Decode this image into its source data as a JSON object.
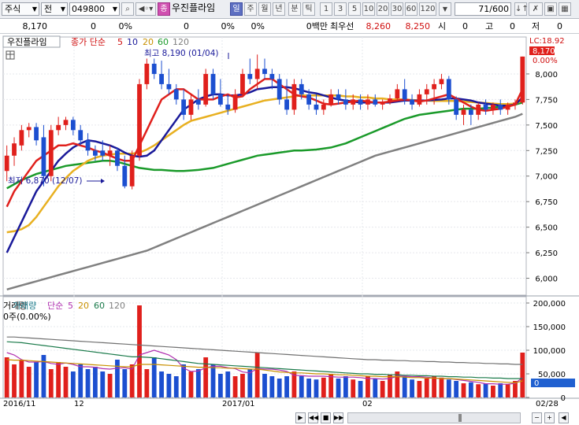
{
  "toolbar": {
    "market": "주식",
    "type": "전",
    "code": "049800",
    "name": "우진플라임",
    "period_day": "일",
    "period_week": "주",
    "period_month": "월",
    "period_year": "년",
    "period_min": "분",
    "period_tick": "틱",
    "intervals": [
      "1",
      "3",
      "5",
      "10",
      "20",
      "30",
      "60",
      "120"
    ],
    "count": "71",
    "total": "/600"
  },
  "info": {
    "price": "8,170",
    "change": "0",
    "change_pct": "0%",
    "volume": "0",
    "vol_pct": "0%",
    "vol_pct2": "0%",
    "amount": "0백만",
    "best_label": "최우선",
    "ask": "8,260",
    "bid": "8,250",
    "open_label": "시",
    "open": "0",
    "high_label": "고",
    "high": "0",
    "low_label": "저",
    "low": "0"
  },
  "price_panel": {
    "title": "우진플라임",
    "ma_label": "종가 단순",
    "ma_periods": [
      "5",
      "10",
      "20",
      "60",
      "120"
    ],
    "lc": "LC:18.92",
    "last": "8,170",
    "last_pct": "0.00%",
    "high_annot": "최고 8,190 (01/04)",
    "low_annot": "최저 6,870 (12/07)"
  },
  "volume_panel": {
    "title": "거래량",
    "ma_label": "단순",
    "ma_periods": [
      "5",
      "20",
      "60",
      "120"
    ],
    "now": "0주(0.00%)",
    "last_tag": "0"
  },
  "x_labels": [
    "2016/11",
    "12",
    "2017/01",
    "02",
    "02/28"
  ],
  "colors": {
    "up": "#e0201c",
    "down": "#1c4fd0",
    "ma5": "#e0201c",
    "ma10": "#1a1a9a",
    "ma20": "#e8b020",
    "ma60": "#1a9a2a",
    "ma120": "#808080"
  },
  "chart_data": {
    "type": "candlestick",
    "price_ylim": [
      5850,
      8300
    ],
    "price_ticks": [
      6000,
      6250,
      6500,
      6750,
      7000,
      7250,
      7500,
      7750,
      8000
    ],
    "price_tick_labels": [
      "6,000",
      "6,250",
      "6,500",
      "6,750",
      "7,000",
      "7,250",
      "7,500",
      "7,750",
      "8,000"
    ],
    "volume_ylim": [
      0,
      210000
    ],
    "volume_ticks": [
      0,
      50000,
      100000,
      150000,
      200000
    ],
    "volume_tick_labels": [
      "0",
      "50,000",
      "100,000",
      "150,000",
      "200,000"
    ],
    "candles": [
      [
        7050,
        7300,
        6950,
        7200
      ],
      [
        7200,
        7380,
        7100,
        7320
      ],
      [
        7300,
        7500,
        7250,
        7450
      ],
      [
        7450,
        7520,
        7380,
        7480
      ],
      [
        7480,
        7520,
        7300,
        7350
      ],
      [
        7380,
        7500,
        6900,
        7000
      ],
      [
        7000,
        7500,
        6950,
        7450
      ],
      [
        7450,
        7580,
        7400,
        7500
      ],
      [
        7500,
        7580,
        7450,
        7550
      ],
      [
        7550,
        7580,
        7400,
        7450
      ],
      [
        7450,
        7500,
        7300,
        7350
      ],
      [
        7350,
        7420,
        7200,
        7250
      ],
      [
        7250,
        7300,
        7150,
        7200
      ],
      [
        7250,
        7350,
        7150,
        7200
      ],
      [
        7200,
        7300,
        7100,
        7250
      ],
      [
        7250,
        7280,
        7050,
        7100
      ],
      [
        7100,
        7200,
        6880,
        6900
      ],
      [
        6900,
        7250,
        6870,
        7200
      ],
      [
        7200,
        7950,
        7150,
        7900
      ],
      [
        7900,
        8150,
        7850,
        8100
      ],
      [
        8100,
        8150,
        7950,
        8000
      ],
      [
        8000,
        8130,
        7850,
        7900
      ],
      [
        7900,
        8050,
        7800,
        7850
      ],
      [
        7850,
        7900,
        7700,
        7750
      ],
      [
        7750,
        7850,
        7550,
        7600
      ],
      [
        7600,
        7800,
        7550,
        7750
      ],
      [
        7750,
        7850,
        7650,
        7700
      ],
      [
        7700,
        8050,
        7680,
        8000
      ],
      [
        8000,
        8050,
        7750,
        7800
      ],
      [
        7800,
        7950,
        7680,
        7700
      ],
      [
        7700,
        7800,
        7600,
        7650
      ],
      [
        7650,
        7850,
        7620,
        7800
      ],
      [
        7800,
        8050,
        7780,
        8000
      ],
      [
        8000,
        8150,
        7900,
        7950
      ],
      [
        7950,
        8190,
        7850,
        8050
      ],
      [
        8050,
        8150,
        7950,
        8000
      ],
      [
        8000,
        8050,
        7850,
        7950
      ],
      [
        7950,
        8000,
        7700,
        7750
      ],
      [
        7750,
        7950,
        7600,
        7650
      ],
      [
        7650,
        7950,
        7600,
        7900
      ],
      [
        7900,
        7950,
        7750,
        7800
      ],
      [
        7800,
        7850,
        7650,
        7700
      ],
      [
        7700,
        7800,
        7600,
        7650
      ],
      [
        7650,
        7750,
        7600,
        7700
      ],
      [
        7700,
        7850,
        7680,
        7800
      ],
      [
        7800,
        7850,
        7700,
        7750
      ],
      [
        7750,
        7850,
        7650,
        7700
      ],
      [
        7700,
        7800,
        7650,
        7750
      ],
      [
        7750,
        7800,
        7650,
        7700
      ],
      [
        7700,
        7800,
        7650,
        7750
      ],
      [
        7750,
        7800,
        7680,
        7700
      ],
      [
        7700,
        7750,
        7650,
        7720
      ],
      [
        7720,
        7800,
        7700,
        7760
      ],
      [
        7760,
        7900,
        7750,
        7850
      ],
      [
        7850,
        7950,
        7700,
        7750
      ],
      [
        7750,
        7800,
        7650,
        7700
      ],
      [
        7700,
        7850,
        7680,
        7800
      ],
      [
        7800,
        7900,
        7700,
        7850
      ],
      [
        7850,
        7950,
        7700,
        7900
      ],
      [
        7900,
        8000,
        7850,
        7950
      ],
      [
        7950,
        7980,
        7700,
        7750
      ],
      [
        7750,
        7780,
        7550,
        7600
      ],
      [
        7600,
        7700,
        7500,
        7650
      ],
      [
        7650,
        7700,
        7500,
        7600
      ],
      [
        7600,
        7720,
        7550,
        7700
      ],
      [
        7700,
        7750,
        7600,
        7650
      ],
      [
        7650,
        7720,
        7600,
        7700
      ],
      [
        7700,
        7750,
        7600,
        7650
      ],
      [
        7650,
        7720,
        7600,
        7700
      ],
      [
        7700,
        7750,
        7650,
        7720
      ],
      [
        7720,
        8170,
        7700,
        8170
      ]
    ],
    "volume": [
      85000,
      70000,
      80000,
      65000,
      75000,
      90000,
      60000,
      75000,
      65000,
      55000,
      70000,
      60000,
      65000,
      55000,
      50000,
      80000,
      60000,
      70000,
      195000,
      60000,
      85000,
      55000,
      50000,
      45000,
      70000,
      55000,
      60000,
      85000,
      70000,
      50000,
      55000,
      45000,
      50000,
      60000,
      95000,
      50000,
      45000,
      40000,
      45000,
      55000,
      45000,
      40000,
      38000,
      42000,
      50000,
      40000,
      45000,
      38000,
      35000,
      45000,
      40000,
      35000,
      48000,
      55000,
      45000,
      38000,
      35000,
      40000,
      45000,
      42000,
      38000,
      35000,
      30000,
      32000,
      28000,
      30000,
      25000,
      30000,
      28000,
      35000,
      95000
    ],
    "ma_series": [
      {
        "name": "5",
        "values": [
          6700,
          6850,
          6950,
          7050,
          7150,
          7200,
          7250,
          7300,
          7300,
          7320,
          7300,
          7280,
          7250,
          7230,
          7200,
          7170,
          7150,
          7150,
          7300,
          7450,
          7600,
          7750,
          7800,
          7850,
          7850,
          7800,
          7750,
          7750,
          7750,
          7780,
          7800,
          7770,
          7780,
          7850,
          7900,
          7950,
          7950,
          7900,
          7850,
          7800,
          7780,
          7770,
          7740,
          7710,
          7700,
          7710,
          7720,
          7730,
          7740,
          7730,
          7720,
          7720,
          7730,
          7740,
          7750,
          7740,
          7730,
          7740,
          7760,
          7780,
          7800,
          7760,
          7720,
          7680,
          7650,
          7640,
          7650,
          7660,
          7680,
          7700,
          7850
        ]
      },
      {
        "name": "10",
        "values": [
          6250,
          6400,
          6550,
          6700,
          6850,
          6950,
          7050,
          7150,
          7220,
          7280,
          7320,
          7350,
          7340,
          7320,
          7300,
          7270,
          7230,
          7200,
          7190,
          7200,
          7250,
          7350,
          7450,
          7550,
          7650,
          7700,
          7750,
          7780,
          7800,
          7800,
          7790,
          7790,
          7800,
          7820,
          7850,
          7860,
          7870,
          7870,
          7870,
          7860,
          7840,
          7820,
          7810,
          7790,
          7770,
          7750,
          7740,
          7730,
          7720,
          7720,
          7720,
          7720,
          7720,
          7730,
          7740,
          7740,
          7740,
          7740,
          7745,
          7750,
          7760,
          7760,
          7750,
          7740,
          7720,
          7710,
          7700,
          7690,
          7690,
          7700,
          7770
        ]
      },
      {
        "name": "20",
        "values": [
          6450,
          6460,
          6480,
          6520,
          6600,
          6700,
          6800,
          6900,
          6980,
          7050,
          7100,
          7150,
          7180,
          7200,
          7210,
          7220,
          7220,
          7220,
          7230,
          7260,
          7300,
          7350,
          7400,
          7450,
          7500,
          7540,
          7560,
          7580,
          7600,
          7620,
          7640,
          7660,
          7680,
          7700,
          7720,
          7740,
          7750,
          7760,
          7770,
          7780,
          7790,
          7790,
          7790,
          7790,
          7790,
          7790,
          7780,
          7780,
          7770,
          7770,
          7760,
          7760,
          7750,
          7750,
          7750,
          7745,
          7740,
          7740,
          7735,
          7735,
          7735,
          7735,
          7730,
          7725,
          7720,
          7715,
          7710,
          7705,
          7705,
          7710,
          7740
        ]
      },
      {
        "name": "60",
        "values": [
          6880,
          6920,
          6960,
          6990,
          7020,
          7040,
          7060,
          7080,
          7100,
          7110,
          7120,
          7130,
          7140,
          7150,
          7150,
          7140,
          7120,
          7100,
          7080,
          7070,
          7060,
          7060,
          7055,
          7050,
          7050,
          7055,
          7060,
          7070,
          7080,
          7100,
          7120,
          7140,
          7160,
          7180,
          7200,
          7210,
          7220,
          7230,
          7240,
          7250,
          7250,
          7255,
          7260,
          7270,
          7280,
          7300,
          7320,
          7350,
          7380,
          7410,
          7440,
          7470,
          7500,
          7530,
          7560,
          7580,
          7600,
          7610,
          7620,
          7630,
          7640,
          7650,
          7660,
          7660,
          7660,
          7665,
          7670,
          7680,
          7690,
          7700,
          7720
        ]
      },
      {
        "name": "120",
        "values": [
          5890,
          5910,
          5930,
          5950,
          5970,
          5990,
          6010,
          6030,
          6050,
          6070,
          6090,
          6110,
          6130,
          6150,
          6170,
          6190,
          6210,
          6230,
          6250,
          6270,
          6300,
          6330,
          6360,
          6390,
          6420,
          6450,
          6480,
          6510,
          6540,
          6570,
          6600,
          6630,
          6660,
          6690,
          6720,
          6750,
          6780,
          6810,
          6840,
          6870,
          6900,
          6930,
          6960,
          6990,
          7020,
          7050,
          7080,
          7110,
          7140,
          7170,
          7200,
          7220,
          7240,
          7260,
          7280,
          7300,
          7320,
          7340,
          7360,
          7380,
          7400,
          7420,
          7440,
          7460,
          7480,
          7500,
          7520,
          7540,
          7560,
          7580,
          7610
        ]
      }
    ],
    "vol_ma_series": [
      {
        "name": "5",
        "values": [
          95000,
          90000,
          80000,
          75000,
          75000,
          76000,
          72000,
          70000,
          73000,
          70000,
          65000,
          65000,
          64000,
          61000,
          60000,
          62000,
          63000,
          60000,
          90000,
          95000,
          100000,
          95000,
          90000,
          80000,
          62000,
          55000,
          56000,
          63000,
          66000,
          66000,
          63000,
          61000,
          54000,
          52000,
          61000,
          60000,
          60000,
          58000,
          55000,
          47000,
          46000,
          45000,
          45000,
          45000,
          44000,
          43000,
          43000,
          43000,
          42000,
          40000,
          40000,
          39000,
          40000,
          45000,
          45000,
          44000,
          44000,
          43000,
          41000,
          40000,
          40000,
          38000,
          36000,
          34000,
          32000,
          29000,
          29000,
          28000,
          28000,
          30000,
          42000
        ]
      },
      {
        "name": "20",
        "values": [
          80000,
          79000,
          79000,
          78000,
          77000,
          76000,
          75000,
          74000,
          73000,
          72000,
          71000,
          70000,
          69000,
          68000,
          67000,
          66000,
          65000,
          65000,
          70000,
          70000,
          70000,
          69000,
          68000,
          67000,
          66000,
          65000,
          64000,
          64000,
          63000,
          63000,
          62000,
          62000,
          61000,
          60000,
          60000,
          58000,
          56000,
          54000,
          53000,
          52000,
          52000,
          51000,
          50000,
          50000,
          49000,
          48000,
          48000,
          47000,
          46000,
          45000,
          45000,
          44000,
          44000,
          44000,
          43000,
          42000,
          42000,
          41000,
          41000,
          40000,
          40000,
          39000,
          38000,
          37000,
          36000,
          35000,
          34000,
          33000,
          32000,
          31000,
          35000
        ]
      },
      {
        "name": "60",
        "values": [
          118000,
          117000,
          116000,
          114000,
          112000,
          110000,
          108000,
          106000,
          104000,
          102000,
          100000,
          98000,
          96000,
          94000,
          92000,
          90000,
          88000,
          86000,
          86000,
          85000,
          84000,
          82000,
          80000,
          78000,
          76000,
          74000,
          72000,
          71000,
          70000,
          69000,
          68000,
          67000,
          66000,
          65000,
          64000,
          63000,
          62000,
          61000,
          60000,
          59000,
          58000,
          57000,
          56000,
          55000,
          54000,
          53000,
          52000,
          51000,
          50000,
          50000,
          49000,
          49000,
          48000,
          48000,
          47000,
          47000,
          46000,
          46000,
          45000,
          45000,
          44000,
          44000,
          43000,
          43000,
          42000,
          42000,
          41000,
          41000,
          40000,
          40000,
          40000
        ]
      },
      {
        "name": "120",
        "values": [
          128000,
          128000,
          127000,
          126000,
          125000,
          124000,
          123000,
          122000,
          121000,
          120000,
          119000,
          118000,
          117000,
          116000,
          115000,
          114000,
          113000,
          112000,
          111000,
          110000,
          109000,
          108000,
          107000,
          106000,
          105000,
          104000,
          103000,
          102000,
          101000,
          100000,
          99000,
          98000,
          97000,
          96000,
          95000,
          94000,
          93000,
          92000,
          91000,
          90000,
          89000,
          88000,
          87000,
          86000,
          85000,
          84000,
          83000,
          82000,
          81000,
          80000,
          80000,
          79000,
          79000,
          78000,
          78000,
          77000,
          77000,
          76000,
          76000,
          75000,
          75000,
          74000,
          74000,
          73000,
          73000,
          72000,
          72000,
          71000,
          71000,
          70000,
          70000
        ]
      }
    ]
  }
}
